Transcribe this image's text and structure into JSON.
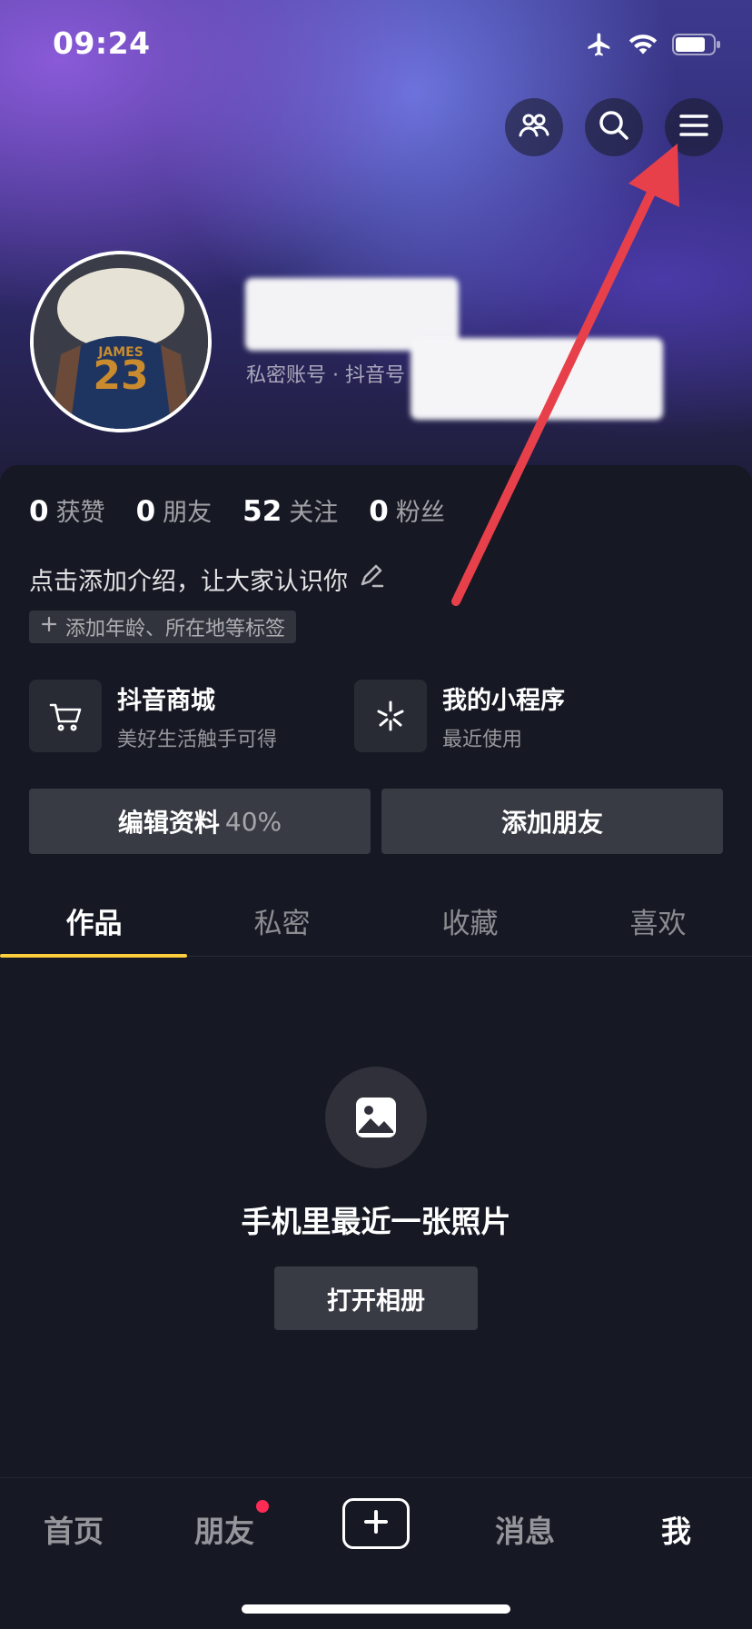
{
  "status_bar": {
    "time": "09:24",
    "icons": [
      "airplane-icon",
      "wifi-icon",
      "battery-icon"
    ]
  },
  "header": {
    "buttons": [
      "friends-icon",
      "search-icon",
      "menu-icon"
    ]
  },
  "profile": {
    "account_info": "私密账号 · 抖音号"
  },
  "stats": [
    {
      "num": "0",
      "label": "获赞"
    },
    {
      "num": "0",
      "label": "朋友"
    },
    {
      "num": "52",
      "label": "关注"
    },
    {
      "num": "0",
      "label": "粉丝"
    }
  ],
  "bio": {
    "text": "点击添加介绍，让大家认识你",
    "tag_chip": "添加年龄、所在地等标签"
  },
  "features": [
    {
      "title": "抖音商城",
      "subtitle": "美好生活触手可得",
      "icon": "cart-icon"
    },
    {
      "title": "我的小程序",
      "subtitle": "最近使用",
      "icon": "mini-program-icon"
    }
  ],
  "actions": {
    "edit_profile": "编辑资料",
    "edit_profile_progress": "40%",
    "add_friends": "添加朋友"
  },
  "tabs": [
    "作品",
    "私密",
    "收藏",
    "喜欢"
  ],
  "active_tab": "作品",
  "empty_state": {
    "title": "手机里最近一张照片",
    "button": "打开相册",
    "icon": "image-icon"
  },
  "bottom_nav": {
    "home": "首页",
    "friends": "朋友",
    "messages": "消息",
    "me": "我"
  },
  "colors": {
    "background": "#161823",
    "tab_indicator": "#fcce3c",
    "notification_dot": "#fe2c55",
    "annotation_arrow": "#e8404a"
  }
}
